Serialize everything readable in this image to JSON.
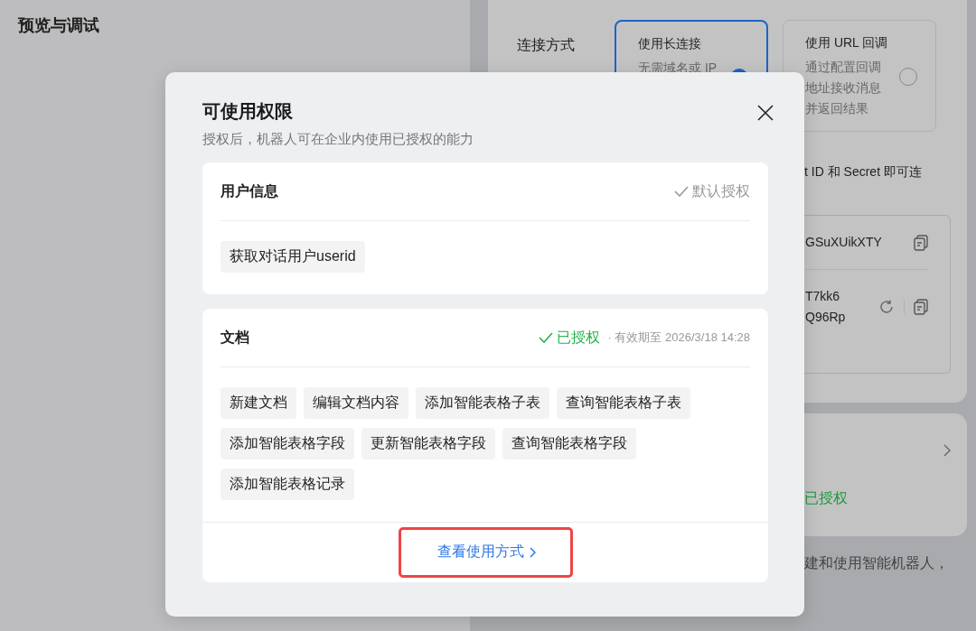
{
  "background": {
    "page_title": "预览与调试",
    "connection": {
      "label": "连接方式",
      "options": [
        {
          "title": "使用长连接",
          "description": [
            "无需域名或 IP"
          ],
          "selected": true
        },
        {
          "title": "使用 URL 回调",
          "description": [
            "通过配置回调",
            "地址接收消息",
            "并返回结果"
          ],
          "selected": false
        }
      ]
    },
    "hint": "t ID 和 Secret 即可连",
    "credentials": [
      {
        "lines": [
          "GSuXUikXTY"
        ],
        "refreshable": false
      },
      {
        "lines": [
          "T7kk6",
          "Q96Rp"
        ],
        "refreshable": true
      }
    ],
    "permission_status": "已授权",
    "footer_text": "建和使用智能机器人，"
  },
  "dialog": {
    "title": "可使用权限",
    "subtitle": "授权后，机器人可在企业内使用已授权的能力",
    "sections": [
      {
        "title": "用户信息",
        "status": {
          "kind": "default",
          "label": "默认授权"
        },
        "tags": [
          "获取对话用户userid"
        ]
      },
      {
        "title": "文档",
        "status": {
          "kind": "granted",
          "label": "已授权",
          "expiry": "· 有效期至 2026/3/18 14:28"
        },
        "tags": [
          "新建文档",
          "编辑文档内容",
          "添加智能表格子表",
          "查询智能表格子表",
          "添加智能表格字段",
          "更新智能表格字段",
          "查询智能表格字段",
          "添加智能表格记录"
        ],
        "link": "查看使用方式"
      }
    ]
  }
}
